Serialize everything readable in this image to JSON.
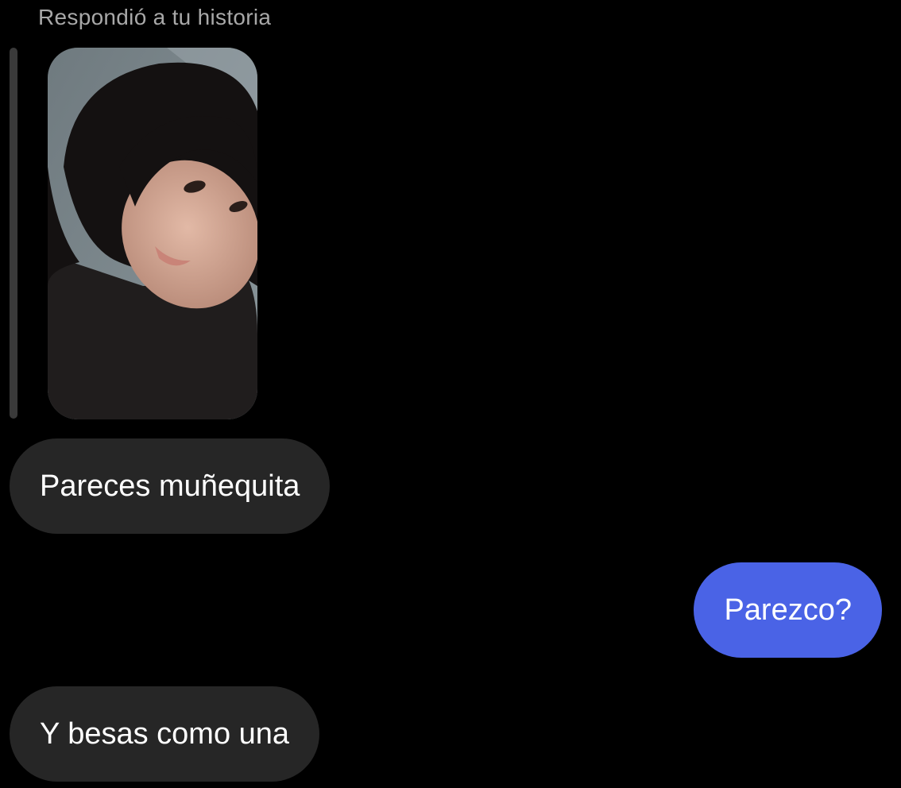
{
  "reply_context": {
    "label": "Respondió a tu historia"
  },
  "messages": [
    {
      "text": "Pareces muñequita",
      "sender": "them"
    },
    {
      "text": "Parezco?",
      "sender": "me"
    },
    {
      "text": "Y besas como una",
      "sender": "them"
    }
  ],
  "colors": {
    "background": "#000000",
    "received_bubble": "#262626",
    "sent_bubble": "#4a63e6",
    "secondary_text": "#a8a8a8"
  }
}
